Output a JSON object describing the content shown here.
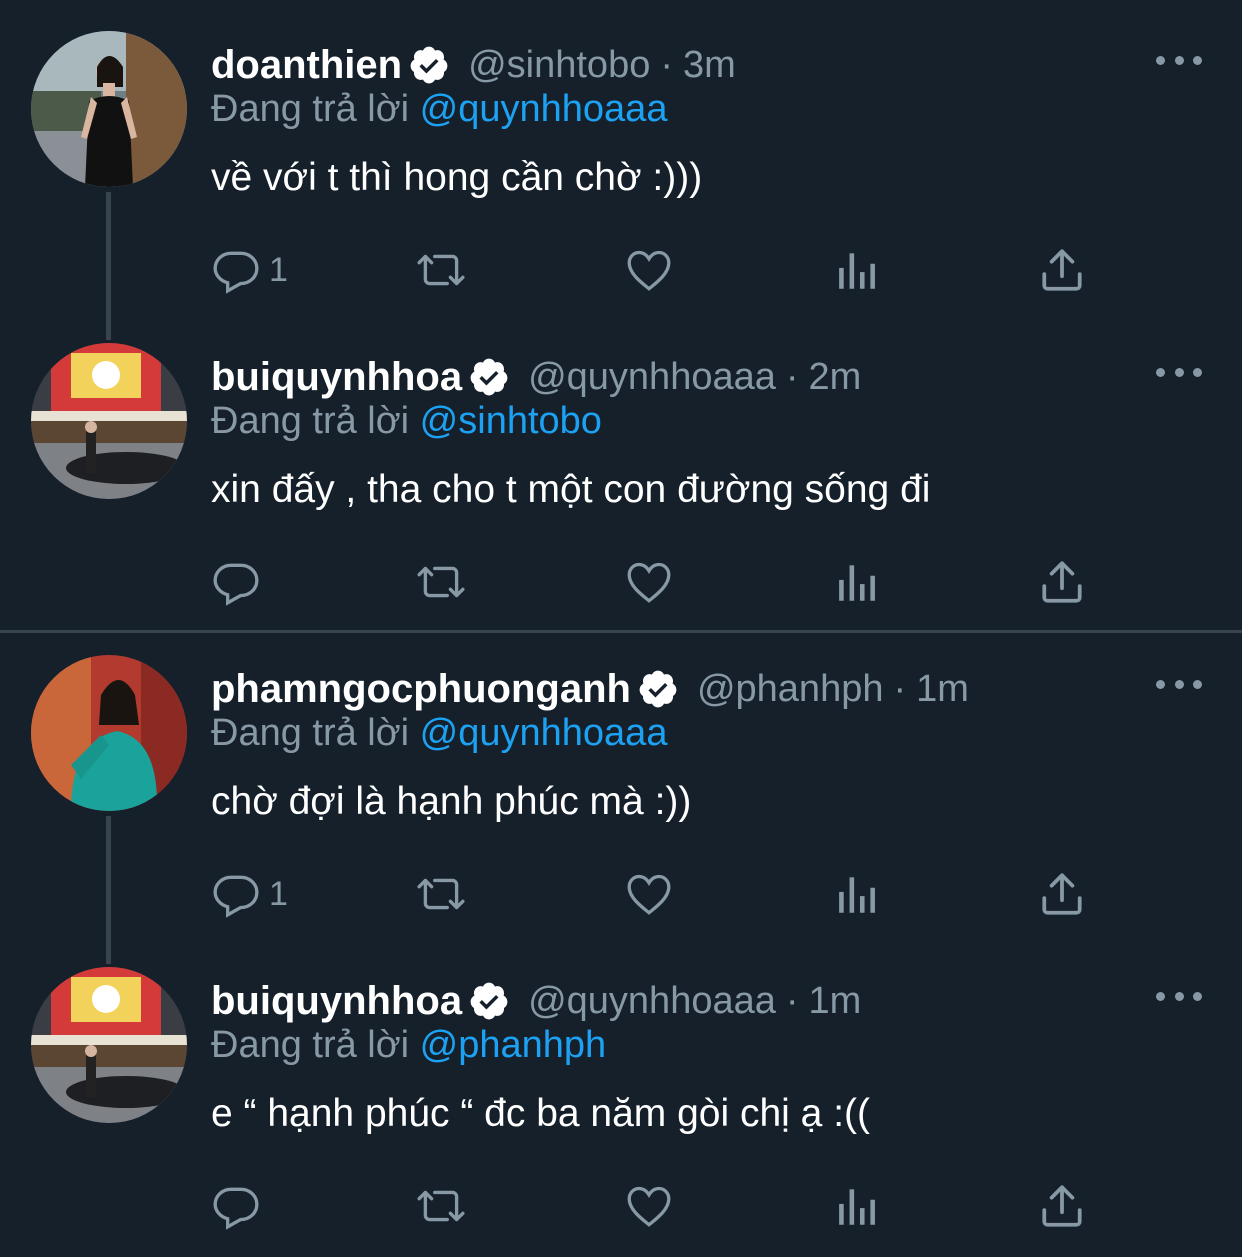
{
  "tweets": [
    {
      "name": "doanthien",
      "handle": "@sinhtobo",
      "separator": "·",
      "time": "3m",
      "reply_prefix": "Đang trả lời",
      "reply_to": "@quynhhoaaa",
      "text": "về với t thì hong cần chờ :)))",
      "reply_count": "1",
      "verified": true
    },
    {
      "name": "buiquynhhoa",
      "handle": "@quynhhoaaa",
      "separator": "·",
      "time": "2m",
      "reply_prefix": "Đang trả lời",
      "reply_to": "@sinhtobo",
      "text": "xin đấy , tha cho t một con đường sống đi",
      "reply_count": "",
      "verified": true
    },
    {
      "name": "phamngocphuonganh",
      "handle": "@phanhph",
      "separator": "·",
      "time": "1m",
      "reply_prefix": "Đang trả lời",
      "reply_to": "@quynhhoaaa",
      "text": "chờ đợi là hạnh phúc mà :))",
      "reply_count": "1",
      "verified": true
    },
    {
      "name": "buiquynhhoa",
      "handle": "@quynhhoaaa",
      "separator": "·",
      "time": "1m",
      "reply_prefix": "Đang trả lời",
      "reply_to": "@phanhph",
      "text": "e “ hạnh phúc “ đc ba năm gòi chị ạ :((",
      "reply_count": "",
      "verified": true
    }
  ],
  "icons": {
    "reply": "reply-icon",
    "retweet": "retweet-icon",
    "like": "heart-icon",
    "analytics": "analytics-icon",
    "share": "share-icon",
    "more": "more-icon",
    "verified": "verified-badge-icon"
  },
  "colors": {
    "background": "#15202b",
    "text": "#ffffff",
    "secondary": "#8899a6",
    "accent": "#1da1f2",
    "divider": "#38444d"
  }
}
